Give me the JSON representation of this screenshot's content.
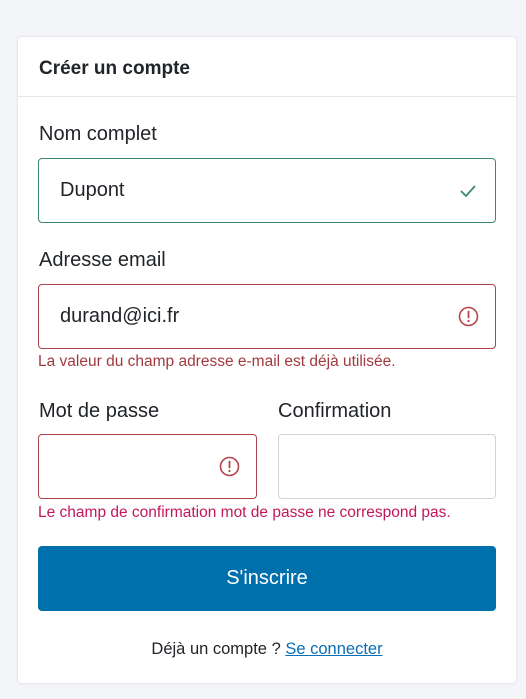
{
  "header": {
    "title": "Créer un compte"
  },
  "form": {
    "name": {
      "label": "Nom complet",
      "value": "Dupont",
      "status": "valid"
    },
    "email": {
      "label": "Adresse email",
      "value": "durand@ici.fr",
      "status": "invalid",
      "error": "La valeur du champ adresse e-mail est déjà utilisée."
    },
    "password": {
      "label": "Mot de passe",
      "value": "",
      "status": "invalid"
    },
    "confirmation": {
      "label": "Confirmation",
      "value": ""
    },
    "password_error": "Le champ de confirmation mot de passe ne correspond pas.",
    "submit_label": "S'inscrire"
  },
  "footer": {
    "prompt": "Déjà un compte ?",
    "login_link": "Se connecter"
  },
  "icons": {
    "valid": "check-icon",
    "invalid": "exclamation-circle-icon"
  },
  "colors": {
    "primary": "#0070ad",
    "valid_border": "#3d8a67",
    "invalid_border": "#a94449",
    "error_text": "#a13a3f",
    "error_text_alt": "#c2185b",
    "link": "#0a6fb5"
  }
}
